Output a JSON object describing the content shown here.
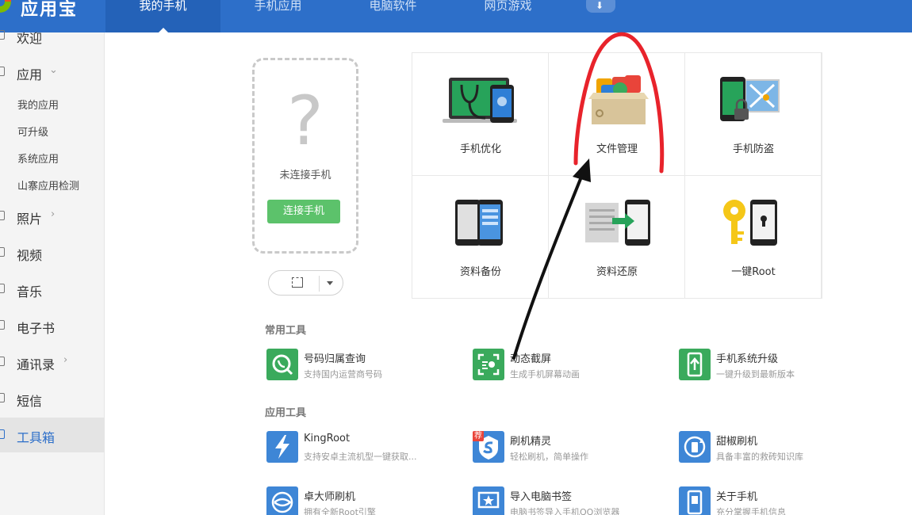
{
  "app": {
    "title": "应用宝"
  },
  "nav": {
    "tabs": [
      {
        "label": "我的手机",
        "active": true
      },
      {
        "label": "手机应用"
      },
      {
        "label": "电脑软件"
      },
      {
        "label": "网页游戏"
      }
    ],
    "download_icon": "download-icon"
  },
  "sidebar": {
    "items": [
      {
        "label": "欢迎"
      },
      {
        "label": "应用"
      },
      {
        "label": "照片"
      },
      {
        "label": "视频"
      },
      {
        "label": "音乐"
      },
      {
        "label": "电子书"
      },
      {
        "label": "通讯录"
      },
      {
        "label": "短信"
      },
      {
        "label": "工具箱",
        "active": true
      }
    ],
    "sub_items": [
      "我的应用",
      "可升级",
      "系统应用",
      "山寨应用检测"
    ]
  },
  "phone": {
    "placeholder_glyph": "?",
    "status": "未连接手机",
    "connect_label": "连接手机"
  },
  "tiles": [
    {
      "label": "手机优化",
      "icon": "phone-optimize-icon"
    },
    {
      "label": "文件管理",
      "icon": "file-manage-icon"
    },
    {
      "label": "手机防盗",
      "icon": "phone-antitheft-icon"
    },
    {
      "label": "资料备份",
      "icon": "data-backup-icon"
    },
    {
      "label": "资料还原",
      "icon": "data-restore-icon"
    },
    {
      "label": "一键Root",
      "icon": "key-root-icon"
    }
  ],
  "common_tools": {
    "title": "常用工具",
    "items": [
      {
        "name": "号码归属查询",
        "desc": "支持国内运营商号码",
        "color": "#3aaa5c"
      },
      {
        "name": "动态截屏",
        "desc": "生成手机屏幕动画",
        "color": "#3aaa5c"
      },
      {
        "name": "手机系统升级",
        "desc": "一键升级到最新版本",
        "color": "#3aaa5c"
      }
    ]
  },
  "app_tools": {
    "title": "应用工具",
    "badge": "荐",
    "items": [
      {
        "name": "KingRoot",
        "desc": "支持安卓主流机型一键获取...",
        "color": "#3e86d6"
      },
      {
        "name": "刷机精灵",
        "desc": "轻松刷机，简单操作",
        "color": "#3e86d6"
      },
      {
        "name": "甜椒刷机",
        "desc": "具备丰富的救砖知识库",
        "color": "#3e86d6"
      },
      {
        "name": "卓大师刷机",
        "desc": "拥有全新Root引擎",
        "color": "#3e86d6"
      },
      {
        "name": "导入电脑书签",
        "desc": "电脑书签导入手机QQ浏览器",
        "color": "#3e86d6"
      },
      {
        "name": "关于手机",
        "desc": "充分掌握手机信息",
        "color": "#3e86d6"
      }
    ]
  },
  "colors": {
    "topbar": "#2d6fc9",
    "accent_green": "#5cc26b",
    "annotation_red": "#e8232b",
    "annotation_black": "#111111"
  }
}
